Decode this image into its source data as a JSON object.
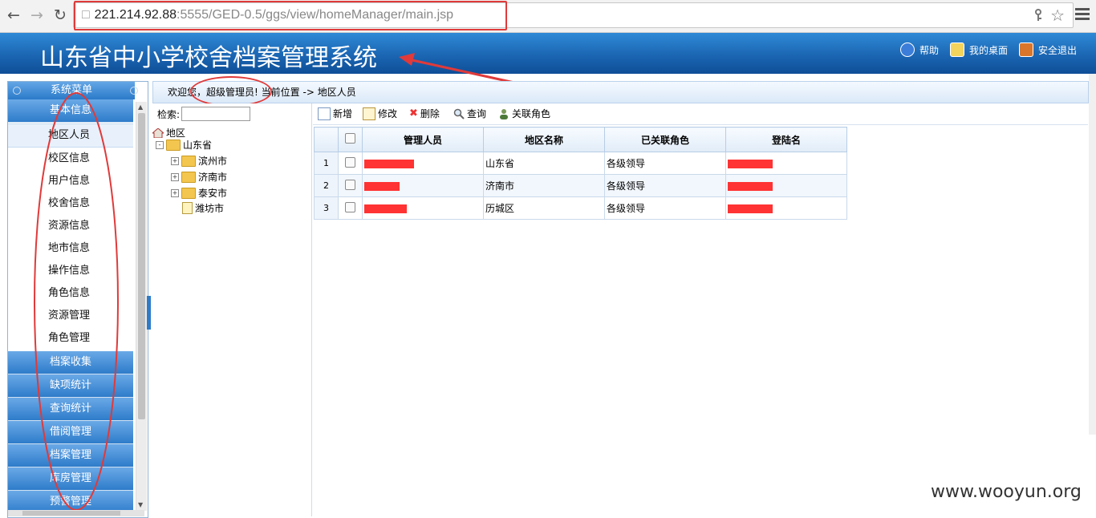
{
  "browser": {
    "url_host": "221.214.92.88",
    "url_rest": ":5555/GED-0.5/ggs/view/homeManager/main.jsp"
  },
  "header": {
    "title": "山东省中小学校舍档案管理系统",
    "links": [
      {
        "label": "帮助",
        "icon": "help-icon",
        "color": "#3b7dd8"
      },
      {
        "label": "我的桌面",
        "icon": "desktop-icon",
        "color": "#f2d35b"
      },
      {
        "label": "安全退出",
        "icon": "exit-icon",
        "color": "#d9762b"
      }
    ]
  },
  "sidebar": {
    "header": "系统菜单",
    "group_top": "基本信息",
    "items": [
      "地区人员",
      "校区信息",
      "用户信息",
      "校舍信息",
      "资源信息",
      "地市信息",
      "操作信息",
      "角色信息",
      "资源管理",
      "角色管理"
    ],
    "groups": [
      "档案收集",
      "缺项统计",
      "查询统计",
      "借阅管理",
      "档案管理",
      "库房管理",
      "预警管理"
    ]
  },
  "breadcrumb": {
    "welcome": "欢迎您，",
    "user": "超级管理员!",
    "location_label": "当前位置",
    "arrow": "->",
    "location": "地区人员"
  },
  "tree": {
    "search_label": "检索:",
    "search_value": "",
    "root": "地区",
    "province": "山东省",
    "cities": [
      "滨州市",
      "济南市",
      "泰安市",
      "潍坊市"
    ]
  },
  "toolbar": {
    "add": "新增",
    "edit": "修改",
    "delete": "删除",
    "query": "查询",
    "link_role": "关联角色"
  },
  "grid": {
    "columns": [
      "管理人员",
      "地区名称",
      "已关联角色",
      "登陆名"
    ],
    "rows": [
      {
        "num": "1",
        "region": "山东省",
        "role": "各级领导"
      },
      {
        "num": "2",
        "region": "济南市",
        "role": "各级领导"
      },
      {
        "num": "3",
        "region": "历城区",
        "role": "各级领导"
      }
    ]
  },
  "watermark": "www.wooyun.org",
  "colors": {
    "header_blue": "#1b66b3",
    "annotation_red": "#e03a3a",
    "redaction_red": "#ff3333"
  }
}
